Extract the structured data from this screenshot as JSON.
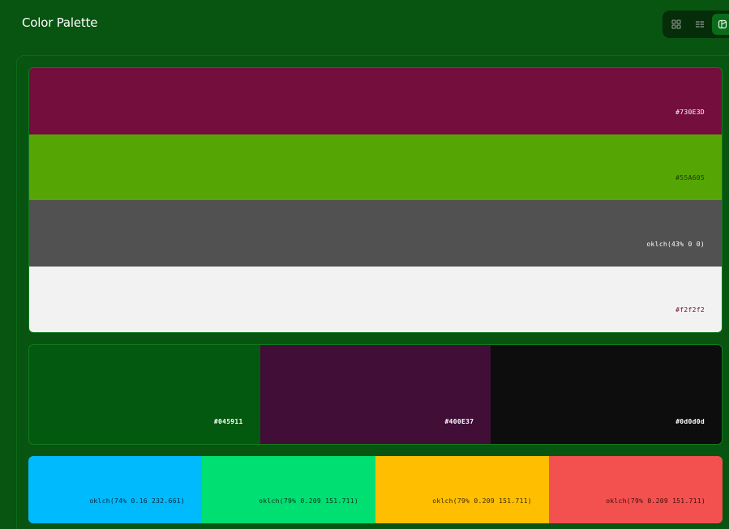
{
  "header": {
    "title": "Color Palette",
    "view_buttons": [
      {
        "icon": "grid-icon",
        "active": false
      },
      {
        "icon": "list-icon",
        "active": false
      },
      {
        "icon": "palette-icon",
        "active": true
      }
    ]
  },
  "palettes": [
    {
      "swatches": [
        {
          "label": "#730E3D",
          "bg": "#730E3D",
          "fg": "#ffffff"
        },
        {
          "label": "#55A605",
          "bg": "#55A605",
          "fg": "#1b3a02"
        },
        {
          "label": "oklch(43% 0 0)",
          "bg": "#515151",
          "fg": "#ffffff"
        },
        {
          "label": "#f2f2f2",
          "bg": "#f2f2f2",
          "fg": "#730E3D"
        }
      ]
    },
    {
      "swatches": [
        {
          "label": "#045911",
          "bg": "#045911",
          "fg": "#ffffff"
        },
        {
          "label": "#400E37",
          "bg": "#400E37",
          "fg": "#ffffff"
        },
        {
          "label": "#0d0d0d",
          "bg": "#0d0d0d",
          "fg": "#ffffff"
        }
      ]
    },
    {
      "swatches": [
        {
          "label": "oklch(74% 0.16 232.661)",
          "bg": "#00BAFE",
          "fg": "#04263a"
        },
        {
          "label": "oklch(79% 0.209 151.711)",
          "bg": "#00DF72",
          "fg": "#03331b"
        },
        {
          "label": "oklch(79% 0.209 151.711)",
          "bg": "#FFBE00",
          "fg": "#3a2b00"
        },
        {
          "label": "oklch(79% 0.209 151.711)",
          "bg": "#F2514F",
          "fg": "#3f0c0b"
        }
      ]
    }
  ]
}
